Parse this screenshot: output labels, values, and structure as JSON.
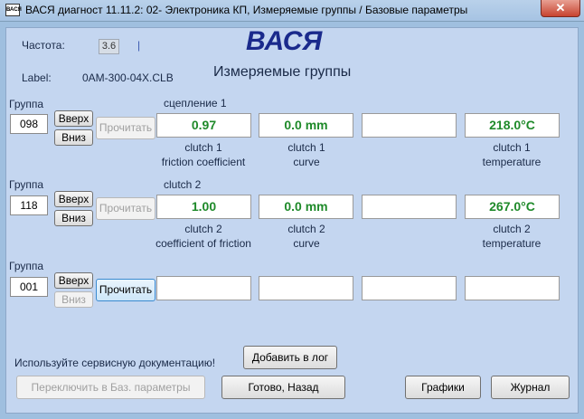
{
  "window": {
    "icon_text": "ВАСЯ",
    "title": "ВАСЯ диагност 11.11.2: 02- Электроника КП,  Измеряемые группы / Базовые параметры",
    "close_label": "✕"
  },
  "header": {
    "freq_label": "Частота:",
    "freq_value": "3.6",
    "freq_marker": "|",
    "label_caption": "Label:",
    "label_value": "0AM-300-04X.CLB",
    "app_title": "ВАСЯ",
    "subtitle": "Измеряемые группы"
  },
  "groups": [
    {
      "label": "Группа",
      "number": "098",
      "up": "Вверх",
      "down": "Вниз",
      "read": "Прочитать",
      "title": "сцепление 1",
      "fields": [
        {
          "value": "0.97",
          "cap1": "clutch 1",
          "cap2": "friction coefficient"
        },
        {
          "value": "0.0 mm",
          "cap1": "clutch 1",
          "cap2": "curve"
        },
        {
          "value": "",
          "cap1": "",
          "cap2": ""
        },
        {
          "value": "218.0°C",
          "cap1": "clutch 1",
          "cap2": "temperature"
        }
      ]
    },
    {
      "label": "Группа",
      "number": "118",
      "up": "Вверх",
      "down": "Вниз",
      "read": "Прочитать",
      "title": "clutch 2",
      "fields": [
        {
          "value": "1.00",
          "cap1": "clutch 2",
          "cap2": "coefficient of friction"
        },
        {
          "value": "0.0 mm",
          "cap1": "clutch 2",
          "cap2": "curve"
        },
        {
          "value": "",
          "cap1": "",
          "cap2": ""
        },
        {
          "value": "267.0°C",
          "cap1": "clutch 2",
          "cap2": "temperature"
        }
      ]
    },
    {
      "label": "Группа",
      "number": "001",
      "up": "Вверх",
      "down": "Вниз",
      "read": "Прочитать",
      "title": "",
      "fields": [
        {
          "value": "",
          "cap1": "",
          "cap2": ""
        },
        {
          "value": "",
          "cap1": "",
          "cap2": ""
        },
        {
          "value": "",
          "cap1": "",
          "cap2": ""
        },
        {
          "value": "",
          "cap1": "",
          "cap2": ""
        }
      ]
    }
  ],
  "footer": {
    "hint": "Используйте сервисную документацию!",
    "add_log": "Добавить в лог",
    "switch_basic": "Переключить в Баз. параметры",
    "done_back": "Готово, Назад",
    "charts": "Графики",
    "journal": "Журнал"
  }
}
